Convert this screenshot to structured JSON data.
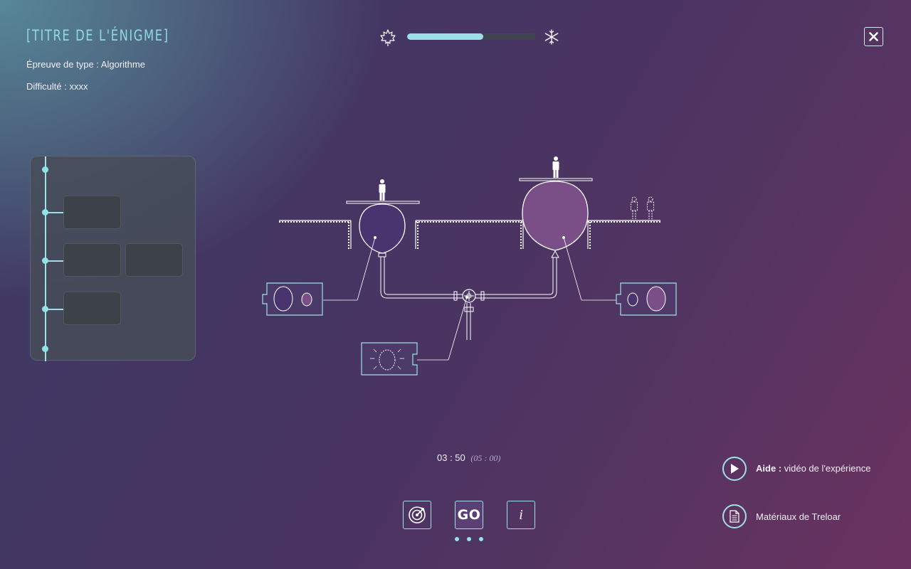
{
  "header": {
    "title": "[TITRE DE L'ÉNIGME]",
    "type_line": "Épreuve de type : Algorithme",
    "difficulty_line": "Difficulté : xxxx"
  },
  "progress": {
    "value": 0.59,
    "left_icon": "maple-leaf-icon",
    "right_icon": "snowflake-icon"
  },
  "close_icon": "close-icon",
  "timeline": {
    "nodes": 5,
    "slots": 4
  },
  "timer": {
    "current": "03 : 50",
    "max": "(05 : 00)"
  },
  "toolbar": {
    "target_icon": "target-icon",
    "go_label": "GO",
    "info_label": "i",
    "page_dots": 3
  },
  "help": {
    "video_bold": "Aide :",
    "video_text": " vidéo de l'expérience",
    "materials_text": "Matériaux de Treloar"
  },
  "colors": {
    "accent": "#9fe0e6",
    "balloon_small": "#4a3470",
    "balloon_large": "#7a4e86",
    "track": "#3f4450"
  }
}
